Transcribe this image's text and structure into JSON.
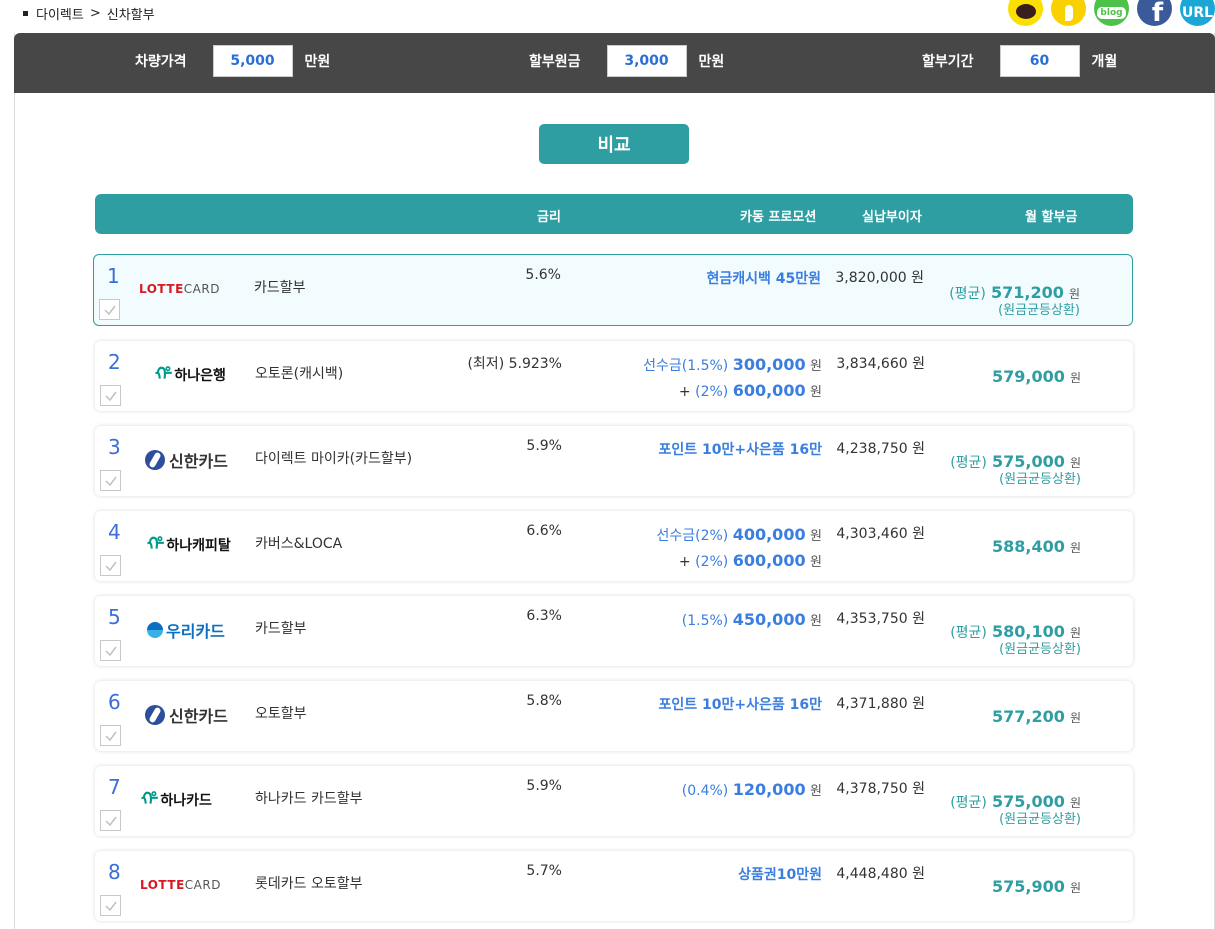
{
  "breadcrumb": {
    "home": "다이렉트",
    "separator": ">",
    "current": "신차할부"
  },
  "social": [
    {
      "name": "kakaotalk-icon"
    },
    {
      "name": "kakaostory-icon"
    },
    {
      "name": "blog-icon",
      "label": "blog"
    },
    {
      "name": "facebook-icon",
      "label": "f"
    },
    {
      "name": "url-icon",
      "label": "URL"
    }
  ],
  "inputs": {
    "price_label": "차량가격",
    "price_value": "5,000",
    "price_unit": "만원",
    "principal_label": "할부원금",
    "principal_value": "3,000",
    "principal_unit": "만원",
    "term_label": "할부기간",
    "term_value": "60",
    "term_unit": "개월"
  },
  "compare_button": "비교",
  "table_header": {
    "rate": "금리",
    "promo": "카동 프로모션",
    "interest": "실납부이자",
    "monthly": "월 할부금"
  },
  "rows": [
    {
      "num": "1",
      "company": "LOTTECARD",
      "product": "카드할부",
      "rate": "5.6%",
      "promo_line1": "현금캐시백 45만원",
      "interest": "3,820,000",
      "won": "원",
      "monthly_prefix": "(평균)",
      "monthly": "571,200",
      "monthly_note": "(원금균등상환)"
    },
    {
      "num": "2",
      "company": "하나은행",
      "product": "오토론(캐시백)",
      "rate": "(최저) 5.923%",
      "promo_a_label": "선수금(1.5%)",
      "promo_a_amt": "300,000",
      "promo_b_plus": "+",
      "promo_b_label": "(2%)",
      "promo_b_amt": "600,000",
      "interest": "3,834,660",
      "won": "원",
      "monthly": "579,000"
    },
    {
      "num": "3",
      "company": "신한카드",
      "product": "다이렉트 마이카(카드할부)",
      "rate": "5.9%",
      "promo_line1": "포인트 10만+사은품 16만",
      "interest": "4,238,750",
      "won": "원",
      "monthly_prefix": "(평균)",
      "monthly": "575,000",
      "monthly_note": "(원금균등상환)"
    },
    {
      "num": "4",
      "company": "하나캐피탈",
      "product": "카버스&LOCA",
      "rate": "6.6%",
      "promo_a_label": "선수금(2%)",
      "promo_a_amt": "400,000",
      "promo_b_plus": "+",
      "promo_b_label": "(2%)",
      "promo_b_amt": "600,000",
      "interest": "4,303,460",
      "won": "원",
      "monthly": "588,400"
    },
    {
      "num": "5",
      "company": "우리카드",
      "product": "카드할부",
      "rate": "6.3%",
      "promo_a_label": "(1.5%)",
      "promo_a_amt": "450,000",
      "interest": "4,353,750",
      "won": "원",
      "monthly_prefix": "(평균)",
      "monthly": "580,100",
      "monthly_note": "(원금균등상환)"
    },
    {
      "num": "6",
      "company": "신한카드",
      "product": "오토할부",
      "rate": "5.8%",
      "promo_line1": "포인트 10만+사은품 16만",
      "interest": "4,371,880",
      "won": "원",
      "monthly": "577,200"
    },
    {
      "num": "7",
      "company": "하나카드",
      "product": "하나카드 카드할부",
      "rate": "5.9%",
      "promo_a_label": "(0.4%)",
      "promo_a_amt": "120,000",
      "interest": "4,378,750",
      "won": "원",
      "monthly_prefix": "(평균)",
      "monthly": "575,000",
      "monthly_note": "(원금균등상환)"
    },
    {
      "num": "8",
      "company": "LOTTECARD",
      "product": "롯데카드 오토할부",
      "rate": "5.7%",
      "promo_line1": "상품권10만원",
      "interest": "4,448,480",
      "won": "원",
      "monthly": "575,900"
    }
  ]
}
